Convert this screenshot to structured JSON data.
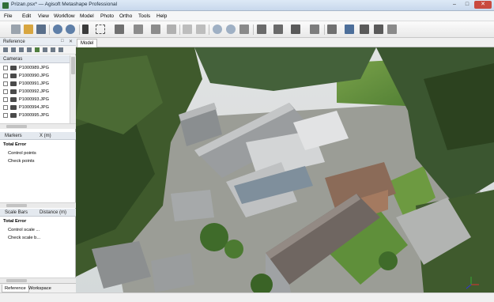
{
  "window": {
    "title": "Prizan.psx* — Agisoft Metashape Professional"
  },
  "menu": [
    "File",
    "Edit",
    "View",
    "Workflow",
    "Model",
    "Photo",
    "Ortho",
    "Tools",
    "Help"
  ],
  "reference_panel": {
    "title": "Reference",
    "cameras_header": "Cameras",
    "cameras": [
      "P1000989.JPG",
      "P1000990.JPG",
      "P1000991.JPG",
      "P1000992.JPG",
      "P1000993.JPG",
      "P1000994.JPG",
      "P1000995.JPG"
    ],
    "markers": {
      "col1": "Markers",
      "col2": "X (m)"
    },
    "markers_error": {
      "total": "Total Error",
      "control": "Control points",
      "check": "Check points"
    },
    "scalebars": {
      "col1": "Scale Bars",
      "col2": "Distance (m)"
    },
    "scalebars_error": {
      "total": "Total Error",
      "control": "Control scale ...",
      "check": "Check scale b..."
    }
  },
  "bottom_tabs": [
    "Reference",
    "Workspace"
  ],
  "model_tab": "Model",
  "colors": {
    "titlebar": "#c8d8ec",
    "close_button": "#c94a3f",
    "panel_bg": "#ffffff"
  }
}
